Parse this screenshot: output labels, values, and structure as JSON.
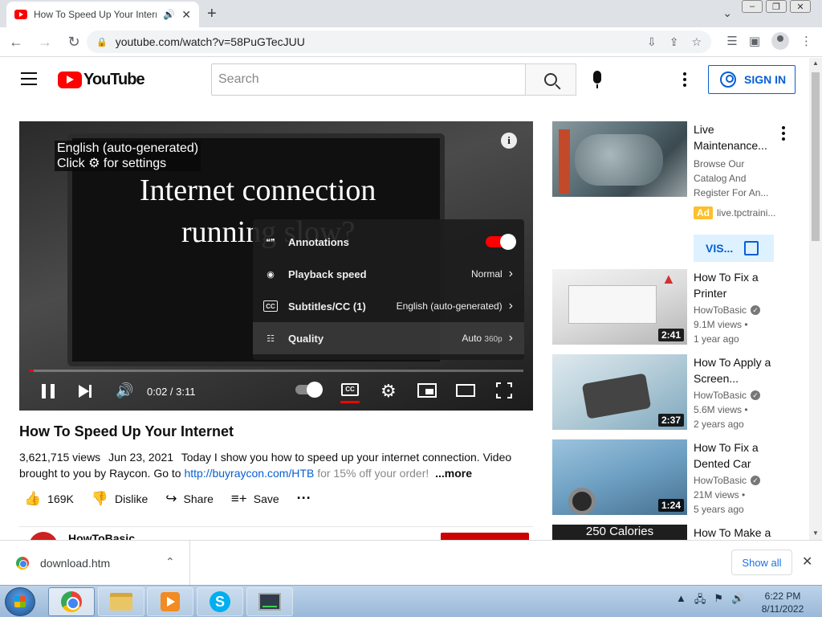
{
  "browser": {
    "tab_title": "How To Speed Up Your Internet",
    "url": "youtube.com/watch?v=58PuGTecJUU",
    "minimize": "–",
    "restore": "❐",
    "close": "✕"
  },
  "masthead": {
    "logo_text": "YouTube",
    "search_placeholder": "Search",
    "sign_in": "SIGN IN"
  },
  "player": {
    "caption_line1": "English (auto-generated)",
    "caption_line2": "Click ⚙ for settings",
    "video_text_line1": "Internet connection",
    "video_text_line2": "running slow?",
    "progress_fraction": 0.0105,
    "time": "0:02 / 3:11",
    "settings": [
      {
        "label": "Annotations",
        "value": "",
        "icon": "annotations-icon"
      },
      {
        "label": "Playback speed",
        "value": "Normal",
        "icon": "playback-speed-icon"
      },
      {
        "label": "Subtitles/CC (1)",
        "value": "English (auto-generated)",
        "icon": "subtitles-icon"
      },
      {
        "label": "Quality",
        "value": "Auto",
        "value_sub": "360p",
        "icon": "quality-icon"
      }
    ]
  },
  "video": {
    "title": "How To Speed Up Your Internet",
    "views": "3,621,715 views",
    "date": "Jun 23, 2021",
    "desc_text": "Today I show you how to speed up your internet connection. Video brought to you by Raycon. Go to",
    "desc_link": "http://buyraycon.com/HTB",
    "desc_tail": "for 15% off your order!",
    "more": "...more",
    "likes": "169K",
    "dislike": "Dislike",
    "share": "Share",
    "save": "Save",
    "channel": "HowToBasic"
  },
  "sidebar": {
    "ad": {
      "title": "Live Maintenance...",
      "desc": "Browse Our Catalog And Register For An...",
      "badge": "Ad",
      "domain": "live.tpctraini...",
      "visit": "VIS..."
    },
    "items": [
      {
        "title": "How To Fix a Printer",
        "channel": "HowToBasic",
        "views": "9.1M views •",
        "age": "1 year ago",
        "duration": "2:41"
      },
      {
        "title": "How To Apply a Screen...",
        "channel": "HowToBasic",
        "views": "5.6M views •",
        "age": "2 years ago",
        "duration": "2:37"
      },
      {
        "title": "How To Fix a Dented Car",
        "channel": "HowToBasic",
        "views": "21M views •",
        "age": "5 years ago",
        "duration": "1:24"
      },
      {
        "title": "How To Make a",
        "thumb_text": "250 Calories"
      }
    ]
  },
  "downloads": {
    "file": "download.htm",
    "show_all": "Show all"
  },
  "taskbar": {
    "time": "6:22 PM",
    "date": "8/11/2022"
  }
}
